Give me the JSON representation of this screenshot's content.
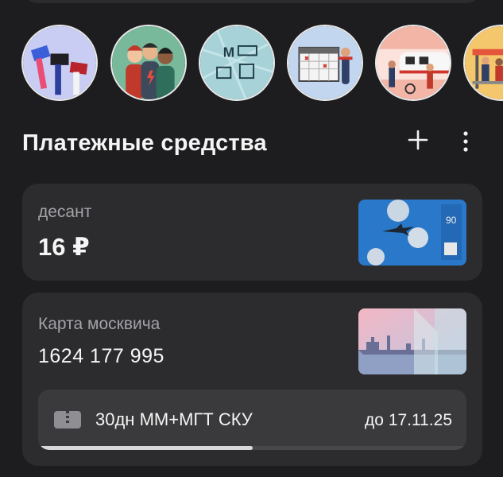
{
  "stories": [
    {
      "name": "story-voting",
      "icon": "hands-with-cards"
    },
    {
      "name": "story-community",
      "icon": "friends-group"
    },
    {
      "name": "story-transport-map",
      "icon": "metro-mcd-map"
    },
    {
      "name": "story-calendar",
      "icon": "calendar"
    },
    {
      "name": "story-station",
      "icon": "train-platform"
    },
    {
      "name": "story-bus-stop",
      "icon": "bus-stop"
    }
  ],
  "section": {
    "title": "Платежные средства",
    "add_icon": "plus-icon",
    "more_icon": "more-vertical-icon"
  },
  "cards": [
    {
      "name": "десант",
      "balance": "16 ₽"
    },
    {
      "name": "Карта москвича",
      "number": "1624 177 995",
      "ticket": {
        "name": "30дн ММ+МГТ СКУ",
        "valid_until": "до 17.11.25",
        "progress": 0.5
      }
    }
  ],
  "colors": {
    "background": "#1d1d1f",
    "card": "#2c2c2e",
    "ticket": "#3a3a3c",
    "muted_text": "#a3a3a8"
  }
}
